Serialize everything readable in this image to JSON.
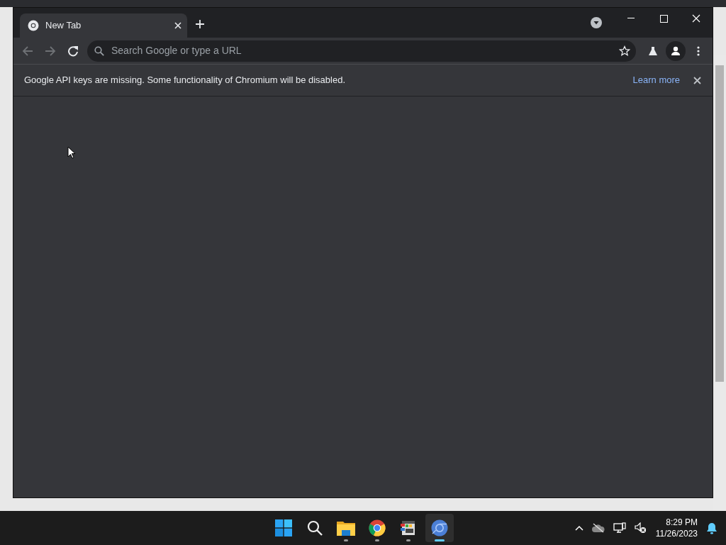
{
  "window": {
    "tabs": [
      {
        "title": "New Tab",
        "selected": true
      }
    ]
  },
  "toolbar": {
    "back_disabled": true,
    "forward_disabled": true,
    "omnibox": {
      "placeholder": "Search Google or type a URL"
    }
  },
  "infobar": {
    "message": "Google API keys are missing. Some functionality of Chromium will be disabled.",
    "link": "Learn more"
  },
  "taskbar": {
    "apps": [
      {
        "kind": "start",
        "running": false,
        "selected": false
      },
      {
        "kind": "search",
        "running": false,
        "selected": false
      },
      {
        "kind": "files",
        "running": true,
        "selected": false
      },
      {
        "kind": "chrome",
        "running": true,
        "selected": false
      },
      {
        "kind": "app",
        "running": true,
        "selected": false
      },
      {
        "kind": "chromium",
        "running": true,
        "selected": true
      }
    ],
    "clock": {
      "time": "8:29 PM",
      "date": "11/26/2023"
    }
  }
}
